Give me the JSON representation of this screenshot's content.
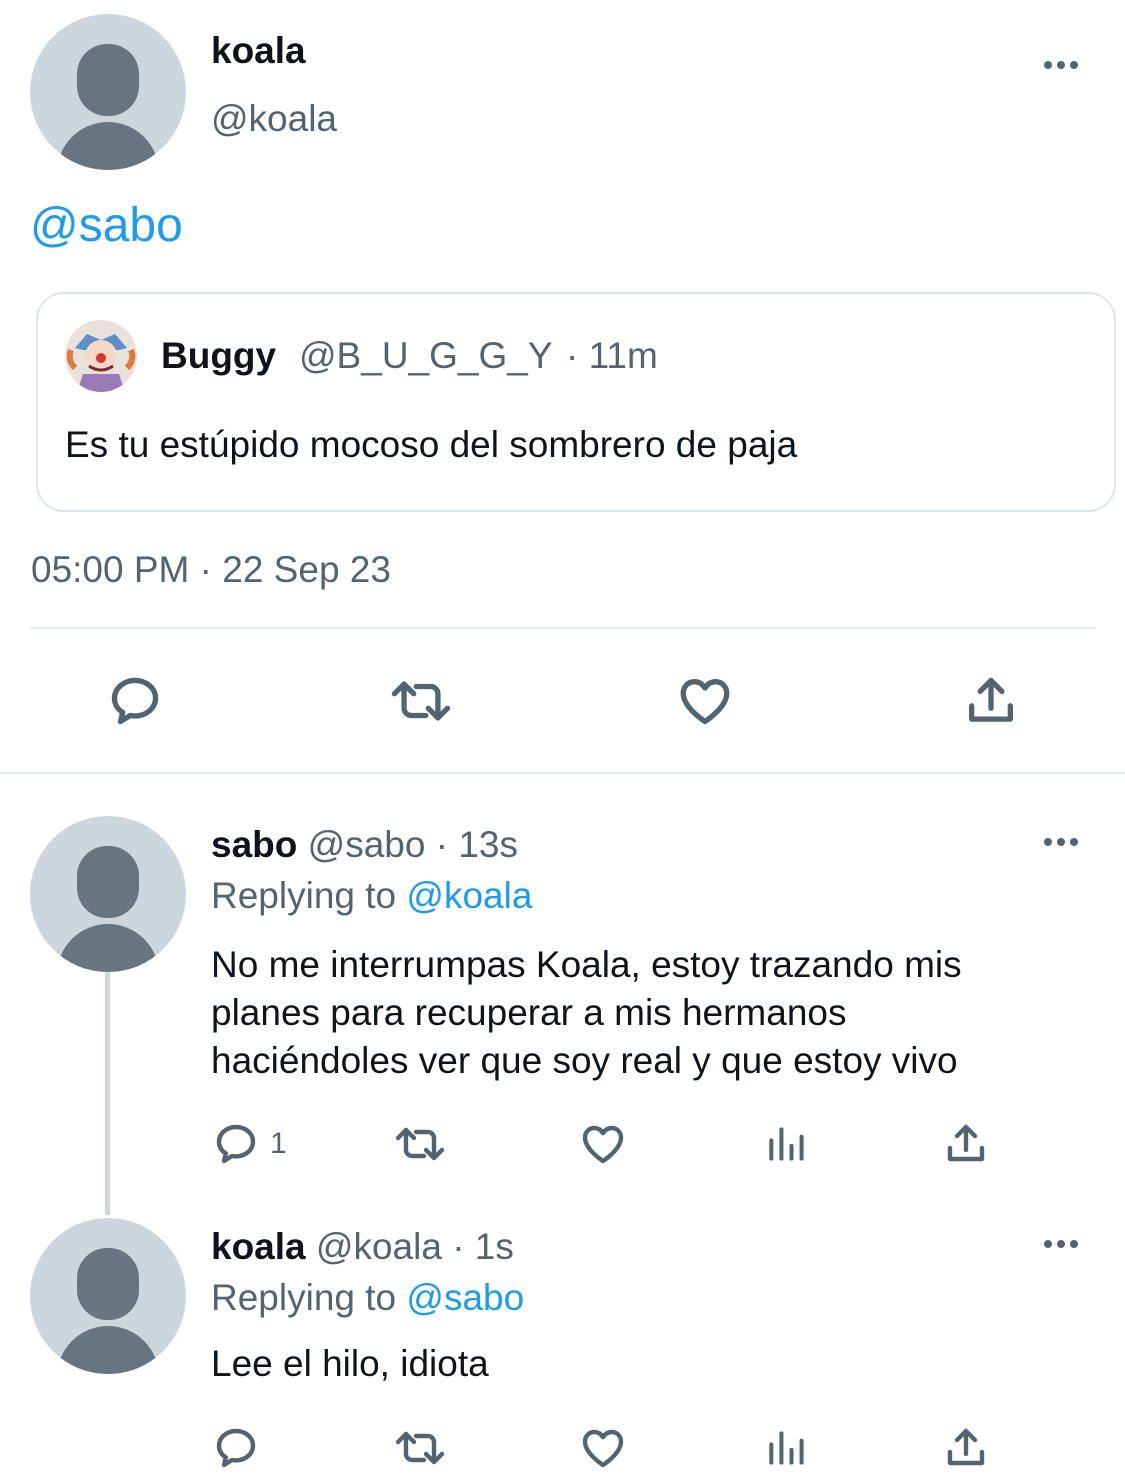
{
  "main_tweet": {
    "name": "koala",
    "handle": "@koala",
    "text": "@sabo",
    "timestamp": "05:00 PM · 22 Sep 23",
    "quoted": {
      "name": "Buggy",
      "handle": "@B_U_G_G_Y",
      "time": "· 11m",
      "text": "Es tu estúpido mocoso del sombrero de paja"
    }
  },
  "replies": [
    {
      "name": "sabo",
      "handle": "@sabo",
      "time": "· 13s",
      "replying_prefix": "Replying to",
      "replying_handle": "@koala",
      "text_lines": [
        "No me interrumpas Koala, estoy trazando mis",
        "planes para recuperar a mis hermanos",
        "haciéndoles ver que soy real y que estoy vivo"
      ],
      "reply_count": "1"
    },
    {
      "name": "koala",
      "handle": "@koala",
      "time": "· 1s",
      "replying_prefix": "Replying to",
      "replying_handle": "@sabo",
      "text": "Lee el hilo, idiota"
    }
  ],
  "colors": {
    "accent": "#1d9bf0",
    "secondary_text": "#536471",
    "avatar_bg": "#ccd6dd",
    "avatar_fg": "#66757f"
  }
}
